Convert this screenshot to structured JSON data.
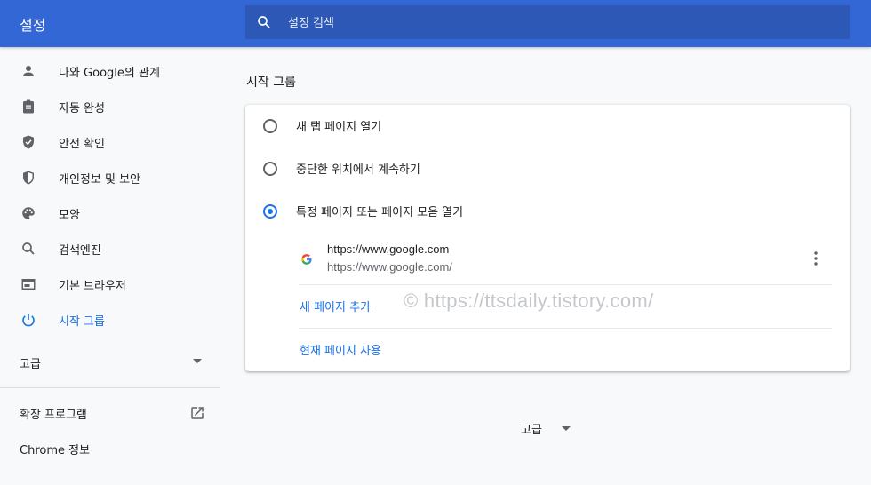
{
  "header": {
    "title": "설정",
    "search_placeholder": "설정 검색"
  },
  "sidebar": {
    "items": [
      {
        "label": "나와 Google의 관계",
        "icon": "person-icon"
      },
      {
        "label": "자동 완성",
        "icon": "clipboard-icon"
      },
      {
        "label": "안전 확인",
        "icon": "shield-check-icon"
      },
      {
        "label": "개인정보 및 보안",
        "icon": "shield-half-icon"
      },
      {
        "label": "모양",
        "icon": "palette-icon"
      },
      {
        "label": "검색엔진",
        "icon": "search-icon"
      },
      {
        "label": "기본 브라우저",
        "icon": "browser-icon"
      },
      {
        "label": "시작 그룹",
        "icon": "power-icon",
        "active": true
      }
    ],
    "advanced_label": "고급",
    "extensions_label": "확장 프로그램",
    "about_label": "Chrome 정보"
  },
  "main": {
    "section_title": "시작 그룹",
    "options": [
      {
        "label": "새 탭 페이지 열기",
        "checked": false
      },
      {
        "label": "중단한 위치에서 계속하기",
        "checked": false
      },
      {
        "label": "특정 페이지 또는 페이지 모음 열기",
        "checked": true
      }
    ],
    "page": {
      "title": "https://www.google.com",
      "url": "https://www.google.com/"
    },
    "add_page_label": "새 페이지 추가",
    "use_current_label": "현재 페이지 사용",
    "watermark": "© https://ttsdaily.tistory.com/",
    "advanced_label": "고급"
  },
  "colors": {
    "header_bg": "#3367d6",
    "accent": "#1a73e8"
  }
}
